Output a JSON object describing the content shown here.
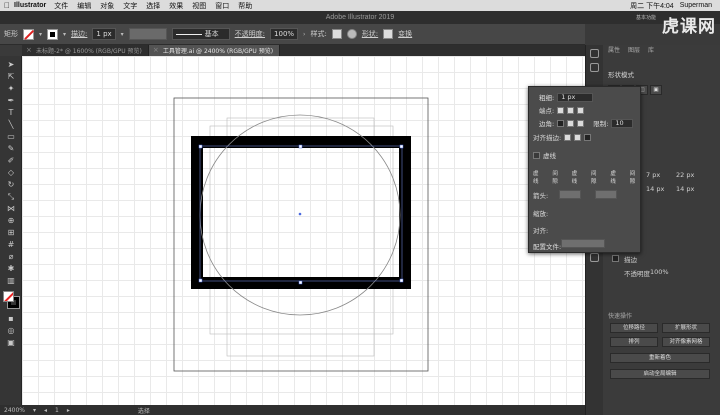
{
  "menubar": {
    "app": "Illustrator",
    "items": [
      "文件",
      "编辑",
      "对象",
      "文字",
      "选择",
      "效果",
      "视图",
      "窗口",
      "帮助"
    ],
    "clock": "周二 下午4:04",
    "user": "Superman"
  },
  "window": {
    "title": "Adobe Illustrator 2019"
  },
  "watermark": {
    "logo": "虎课网",
    "sub": "基本功能"
  },
  "controlbar": {
    "shape_label": "矩形",
    "stroke_label": "描边:",
    "stroke_value": "1 px",
    "brush_label": "基本",
    "opacity_label": "不透明度:",
    "opacity_value": "100%",
    "style_label": "样式:",
    "shape2_label": "形状:",
    "transform_label": "变换"
  },
  "tabs": [
    {
      "label": "未标题-2* @ 1600% (RGB/GPU 预览)",
      "active": false
    },
    {
      "label": "工具管理.ai @ 2400% (RGB/GPU 预览)",
      "active": true
    }
  ],
  "status": {
    "zoom": "2400%",
    "page": "1",
    "tool": "选择"
  },
  "stroke_panel": {
    "weight_label": "粗细:",
    "weight_value": "1 px",
    "cap_label": "端点:",
    "corner_label": "边角:",
    "limit_label": "限制:",
    "limit_value": "10",
    "align_label": "对齐描边:",
    "dashed_label": "虚线",
    "dash_labels": [
      "虚线",
      "间隙",
      "虚线",
      "间隙",
      "虚线",
      "间隙"
    ],
    "arrow_label": "箭头:",
    "scale_label": "缩放:",
    "align2_label": "对齐:",
    "profile_label": "配置文件:"
  },
  "right_panel": {
    "tabs": [
      "属性",
      "图层",
      "库"
    ],
    "section_title": "形状模式",
    "values": {
      "w": "7 px",
      "h": "22 px",
      "x2": "14 px",
      "h2": "14 px"
    },
    "stroke_label": "描边",
    "opacity_label": "不透明度",
    "opacity_value": "100%",
    "quick_actions_title": "快速操作",
    "buttons": [
      "位移路径",
      "扩展形状",
      "排列",
      "对齐像素网格",
      "重新着色",
      "启动全局编辑"
    ]
  },
  "colors": {
    "accent": "#d22222",
    "canvas_bg": "#ffffff",
    "ui_bg": "#3a3a3a"
  }
}
